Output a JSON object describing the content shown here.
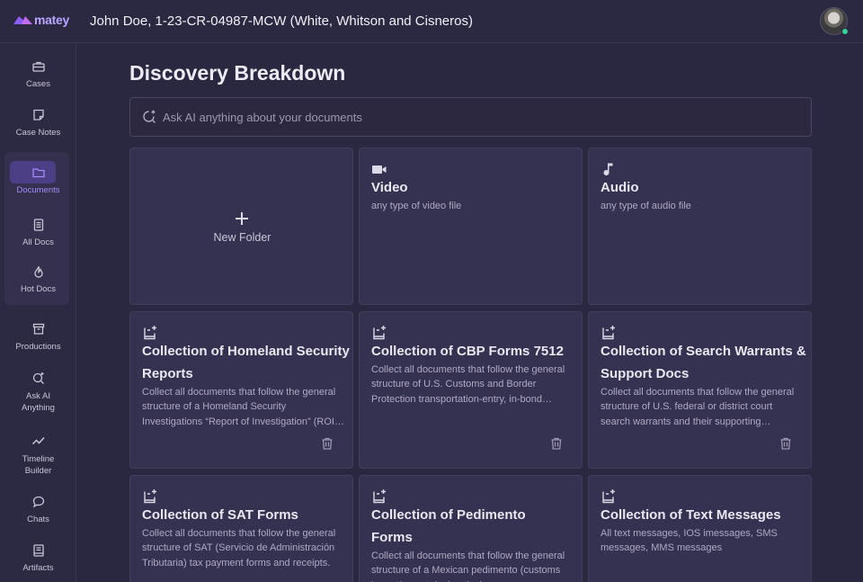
{
  "app": {
    "logo_text": "matey",
    "case_title": "John Doe, 1-23-CR-04987-MCW (White, Whitson and Cisneros)"
  },
  "colors": {
    "accent": "#a78bfa",
    "active_bg": "#4c3f86",
    "status_online": "#34d399"
  },
  "sidebar": {
    "items": [
      {
        "label": "Cases",
        "icon": "briefcase-icon"
      },
      {
        "label": "Case Notes",
        "icon": "note-icon"
      },
      {
        "label": "Documents",
        "icon": "folder-icon",
        "active": true
      },
      {
        "label": "All Docs",
        "icon": "document-icon"
      },
      {
        "label": "Hot Docs",
        "icon": "flame-icon"
      },
      {
        "label": "Productions",
        "icon": "archive-icon"
      },
      {
        "label": "Ask AI Anything",
        "icon": "ai-search-icon"
      },
      {
        "label": "Timeline Builder",
        "icon": "trend-line-icon"
      },
      {
        "label": "Chats",
        "icon": "chat-bubble-icon"
      },
      {
        "label": "Artifacts",
        "icon": "artifact-icon"
      }
    ]
  },
  "main": {
    "title": "Discovery Breakdown",
    "search": {
      "placeholder": "Ask AI anything about your documents"
    },
    "new_folder_label": "New Folder",
    "cards": [
      {
        "title": "Video",
        "description": "any type of video file",
        "icon": "video-camera-icon"
      },
      {
        "title": "Audio",
        "description": "any type of audio file",
        "icon": "music-note-icon"
      },
      {
        "title": "Collection of Homeland Security Reports",
        "description": "Collect all documents that follow the general structure of a Homeland Security Investigations “Report of Investigation” (ROI) used to document law enforcement findings.",
        "icon": "ai-collection-icon"
      },
      {
        "title": "Collection of CBP Forms 7512",
        "description": "Collect all documents that follow the general structure of U.S. Customs and Border Protection transportation-entry, in-bond documents.",
        "icon": "ai-collection-icon"
      },
      {
        "title": "Collection of Search Warrants & Support Docs",
        "description": "Collect all documents that follow the general structure of U.S. federal or district court search warrants and their supporting affidavits.",
        "icon": "ai-collection-icon"
      },
      {
        "title": "Collection of SAT Forms",
        "description": "Collect all documents that follow the general structure of SAT (Servicio de Administración Tributaria) tax payment forms and receipts.",
        "icon": "ai-collection-icon"
      },
      {
        "title": "Collection of Pedimento Forms",
        "description": "Collect all documents that follow the general structure of a Mexican pedimento (customs import/export declaration).",
        "icon": "ai-collection-icon"
      },
      {
        "title": "Collection of Text Messages",
        "description": "All text messages, IOS imessages, SMS messages, MMS messages",
        "icon": "ai-collection-icon"
      }
    ]
  }
}
